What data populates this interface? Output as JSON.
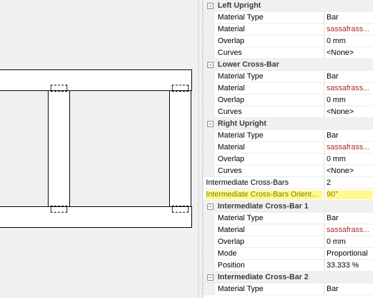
{
  "property_grid": {
    "rows": [
      {
        "kind": "category",
        "title": "Left Upright",
        "toggle": "−"
      },
      {
        "kind": "prop",
        "name": "Material Type",
        "value": "Bar"
      },
      {
        "kind": "prop",
        "name": "Material",
        "value": "sassafrass...",
        "material": true
      },
      {
        "kind": "prop",
        "name": "Overlap",
        "value": "0 mm"
      },
      {
        "kind": "prop",
        "name": "Curves",
        "value": "<None>"
      },
      {
        "kind": "category",
        "title": "Lower Cross-Bar",
        "toggle": "−"
      },
      {
        "kind": "prop",
        "name": "Material Type",
        "value": "Bar"
      },
      {
        "kind": "prop",
        "name": "Material",
        "value": "sassafrass...",
        "material": true
      },
      {
        "kind": "prop",
        "name": "Overlap",
        "value": "0 mm"
      },
      {
        "kind": "prop",
        "name": "Curves",
        "value": "<None>"
      },
      {
        "kind": "category",
        "title": "Right Upright",
        "toggle": "−"
      },
      {
        "kind": "prop",
        "name": "Material Type",
        "value": "Bar"
      },
      {
        "kind": "prop",
        "name": "Material",
        "value": "sassafrass...",
        "material": true
      },
      {
        "kind": "prop",
        "name": "Overlap",
        "value": "0 mm"
      },
      {
        "kind": "prop",
        "name": "Curves",
        "value": "<None>"
      },
      {
        "kind": "top",
        "name": "Intermediate Cross-Bars",
        "value": "2"
      },
      {
        "kind": "top",
        "name": "Intermediate Cross-Bars Orientation",
        "value": "90°",
        "highlight": true
      },
      {
        "kind": "category",
        "title": "Intermediate Cross-Bar 1",
        "toggle": "−"
      },
      {
        "kind": "prop",
        "name": "Material Type",
        "value": "Bar"
      },
      {
        "kind": "prop",
        "name": "Material",
        "value": "sassafrass...",
        "material": true
      },
      {
        "kind": "prop",
        "name": "Overlap",
        "value": "0 mm"
      },
      {
        "kind": "prop",
        "name": "Mode",
        "value": "Proportional"
      },
      {
        "kind": "prop",
        "name": "Position",
        "value": "33.333 %"
      },
      {
        "kind": "category",
        "title": "Intermediate Cross-Bar 2",
        "toggle": "−"
      },
      {
        "kind": "prop",
        "name": "Material Type",
        "value": "Bar"
      }
    ]
  }
}
